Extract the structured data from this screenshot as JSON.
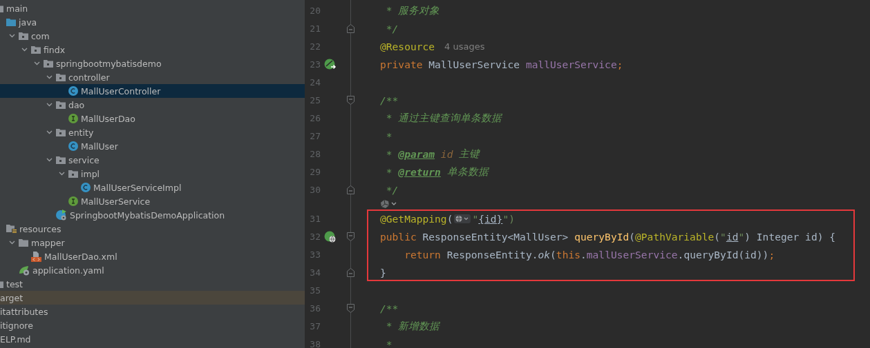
{
  "project_tree": {
    "items": [
      {
        "label": "main",
        "kind": "source-root",
        "selected": false,
        "children": [
          {
            "label": "java",
            "kind": "java-folder",
            "selected": false,
            "children": [
              {
                "label": "com",
                "kind": "package",
                "expanded": true,
                "selected": false,
                "children": [
                  {
                    "label": "findx",
                    "kind": "package",
                    "expanded": true,
                    "selected": false,
                    "children": [
                      {
                        "label": "springbootmybatisdemo",
                        "kind": "package",
                        "expanded": true,
                        "selected": false,
                        "children": [
                          {
                            "label": "controller",
                            "kind": "package",
                            "expanded": true,
                            "selected": false,
                            "children": [
                              {
                                "label": "MallUserController",
                                "kind": "class",
                                "selected": true
                              }
                            ]
                          },
                          {
                            "label": "dao",
                            "kind": "package",
                            "expanded": true,
                            "selected": false,
                            "children": [
                              {
                                "label": "MallUserDao",
                                "kind": "interface",
                                "selected": false
                              }
                            ]
                          },
                          {
                            "label": "entity",
                            "kind": "package",
                            "expanded": true,
                            "selected": false,
                            "children": [
                              {
                                "label": "MallUser",
                                "kind": "class",
                                "selected": false
                              }
                            ]
                          },
                          {
                            "label": "service",
                            "kind": "package",
                            "expanded": true,
                            "selected": false,
                            "children": [
                              {
                                "label": "impl",
                                "kind": "package",
                                "expanded": true,
                                "selected": false,
                                "children": [
                                  {
                                    "label": "MallUserServiceImpl",
                                    "kind": "class",
                                    "selected": false
                                  }
                                ]
                              },
                              {
                                "label": "MallUserService",
                                "kind": "interface",
                                "selected": false
                              }
                            ]
                          },
                          {
                            "label": "SpringbootMybatisDemoApplication",
                            "kind": "spring-app",
                            "selected": false
                          }
                        ]
                      }
                    ]
                  }
                ]
              }
            ]
          },
          {
            "label": "resources",
            "kind": "resources-folder",
            "selected": false,
            "children": [
              {
                "label": "mapper",
                "kind": "folder",
                "expanded": true,
                "selected": false,
                "children": [
                  {
                    "label": "MallUserDao.xml",
                    "kind": "xml",
                    "selected": false
                  }
                ]
              },
              {
                "label": "application.yaml",
                "kind": "yaml",
                "selected": false
              }
            ]
          }
        ]
      },
      {
        "label": "test",
        "kind": "source-root",
        "selected": false
      }
    ],
    "outer_items": [
      {
        "label": "arget",
        "highlighted": true
      },
      {
        "label": "itattributes",
        "highlighted": false
      },
      {
        "label": "itignore",
        "highlighted": false
      },
      {
        "label": "ELP.md",
        "highlighted": false
      }
    ]
  },
  "code": {
    "lines": [
      {
        "kind": "code",
        "number": "20",
        "tokens": [
          {
            "text": " * 服务对象",
            "kind": "comment"
          }
        ]
      },
      {
        "kind": "code",
        "number": "21",
        "fold_end": true,
        "tokens": [
          {
            "text": " */",
            "kind": "comment"
          }
        ]
      },
      {
        "kind": "code",
        "number": "22",
        "tokens": [
          {
            "text": "@Resource",
            "kind": "annotation"
          },
          {
            "text": "4 usages",
            "kind": "inlay"
          }
        ]
      },
      {
        "kind": "code",
        "number": "23",
        "bean_icon": true,
        "tokens": [
          {
            "text": "private",
            "kind": "keyword"
          },
          {
            "text": " MallUserService ",
            "kind": "plain"
          },
          {
            "text": "mallUserService",
            "kind": "field"
          },
          {
            "text": ";",
            "kind": "keyword"
          }
        ]
      },
      {
        "kind": "code",
        "number": "24"
      },
      {
        "kind": "code",
        "number": "25",
        "fold_start": true,
        "tokens": [
          {
            "text": "/**",
            "kind": "comment"
          }
        ]
      },
      {
        "kind": "code",
        "number": "26",
        "tokens": [
          {
            "text": " * 通过主键查询单条数据",
            "kind": "comment"
          }
        ]
      },
      {
        "kind": "code",
        "number": "27",
        "tokens": [
          {
            "text": " *",
            "kind": "comment"
          }
        ]
      },
      {
        "kind": "code",
        "number": "28",
        "tokens": [
          {
            "text": " * ",
            "kind": "comment"
          },
          {
            "text": "@param",
            "kind": "doc-tag"
          },
          {
            "text": " id",
            "kind": "param-name"
          },
          {
            "text": " 主键",
            "kind": "comment"
          }
        ]
      },
      {
        "kind": "code",
        "number": "29",
        "tokens": [
          {
            "text": " * ",
            "kind": "comment"
          },
          {
            "text": "@return",
            "kind": "doc-tag"
          },
          {
            "text": " 单条数据",
            "kind": "comment"
          }
        ]
      },
      {
        "kind": "code",
        "number": "30",
        "fold_end": true,
        "tokens": [
          {
            "text": " */",
            "kind": "comment"
          }
        ]
      },
      {
        "kind": "hints"
      },
      {
        "kind": "code",
        "number": "31",
        "boxed": true,
        "tokens": [
          {
            "text": "@GetMapping",
            "kind": "annotation"
          },
          {
            "text": "(",
            "kind": "plain"
          },
          {
            "kind": "globe-inlay"
          },
          {
            "text": "\"",
            "kind": "string"
          },
          {
            "text": "{id}",
            "kind": "string-ref"
          },
          {
            "text": "\")",
            "kind": "string"
          }
        ]
      },
      {
        "kind": "code",
        "number": "32",
        "boxed": true,
        "endpoint_icon": true,
        "fold_start": true,
        "tokens": [
          {
            "text": "public",
            "kind": "keyword"
          },
          {
            "text": " ResponseEntity<MallUser> ",
            "kind": "plain"
          },
          {
            "text": "queryById",
            "kind": "method-decl"
          },
          {
            "text": "(",
            "kind": "plain"
          },
          {
            "text": "@PathVariable",
            "kind": "annotation"
          },
          {
            "text": "(",
            "kind": "plain"
          },
          {
            "text": "\"",
            "kind": "string"
          },
          {
            "text": "id",
            "kind": "string-ref"
          },
          {
            "text": "\"",
            "kind": "string"
          },
          {
            "text": ") Integer id) {",
            "kind": "plain"
          }
        ]
      },
      {
        "kind": "code",
        "number": "33",
        "boxed": true,
        "tokens": [
          {
            "text": "    return",
            "kind": "keyword"
          },
          {
            "text": " ResponseEntity.",
            "kind": "plain"
          },
          {
            "text": "ok",
            "kind": "static-call"
          },
          {
            "text": "(",
            "kind": "plain"
          },
          {
            "text": "this",
            "kind": "keyword"
          },
          {
            "text": ".",
            "kind": "plain"
          },
          {
            "text": "mallUserService",
            "kind": "field"
          },
          {
            "text": ".queryById(id))",
            "kind": "plain"
          },
          {
            "text": ";",
            "kind": "keyword"
          }
        ]
      },
      {
        "kind": "code",
        "number": "34",
        "boxed": true,
        "fold_end": true,
        "tokens": [
          {
            "text": "}",
            "kind": "plain"
          }
        ]
      },
      {
        "kind": "code",
        "number": "35"
      },
      {
        "kind": "code",
        "number": "36",
        "fold_start": true,
        "tokens": [
          {
            "text": "/**",
            "kind": "comment"
          }
        ]
      },
      {
        "kind": "code",
        "number": "37",
        "tokens": [
          {
            "text": " * 新增数据",
            "kind": "comment"
          }
        ]
      },
      {
        "kind": "code",
        "number": "38",
        "tokens": [
          {
            "text": " *",
            "kind": "comment"
          }
        ]
      }
    ]
  }
}
